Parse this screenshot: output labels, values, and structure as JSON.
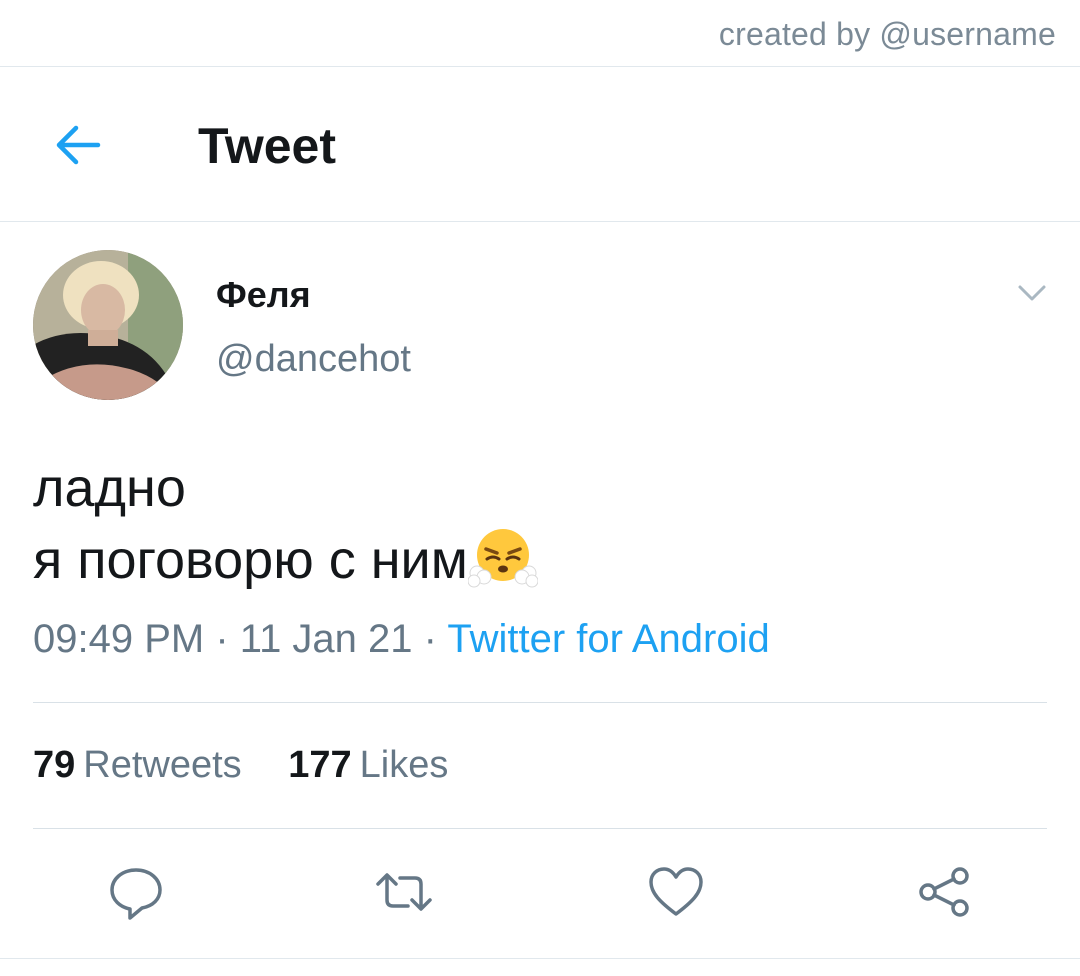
{
  "credit": "created by @username",
  "header": {
    "title": "Tweet",
    "back_icon": "arrow-left-icon"
  },
  "author": {
    "display_name": "Феля",
    "handle": "@dancehot",
    "menu_icon": "chevron-down-icon"
  },
  "tweet": {
    "lines": [
      "ладно",
      "я поговорю с ним"
    ],
    "emoji": "face-with-steam-from-nose-emoji"
  },
  "meta": {
    "time": "09:49 PM",
    "separator": "·",
    "date": "11 Jan 21",
    "source": "Twitter for Android"
  },
  "stats": {
    "retweets_count": "79",
    "retweets_label": "Retweets",
    "likes_count": "177",
    "likes_label": "Likes"
  },
  "actions": [
    "reply-icon",
    "retweet-icon",
    "like-icon",
    "share-icon"
  ],
  "colors": {
    "accent": "#1da1f2",
    "text_primary": "#14171a",
    "text_secondary": "#657786",
    "divider": "#e1e8ed"
  }
}
